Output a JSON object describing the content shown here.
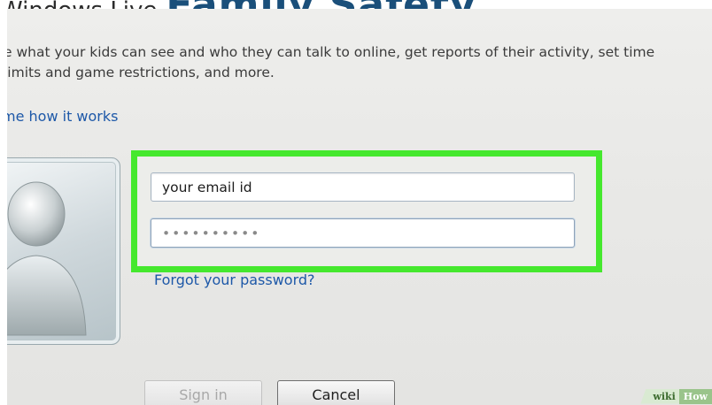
{
  "header": {
    "partial_title": "Windows Live",
    "partial_title_large": "Family Safety"
  },
  "description": "e what your kids can see and who they can talk to online, get reports of their activity, set time limits and game restrictions, and more.",
  "how_it_works_link": "me how it works",
  "signin_form": {
    "email_value": "your email id",
    "password_mask": "••••••••••",
    "forgot_password_link": "Forgot your password?",
    "highlight_color": "#45e82e"
  },
  "buttons": {
    "signin_label": "Sign in",
    "cancel_label": "Cancel"
  },
  "watermark": {
    "part1": "wiki",
    "part2": "How"
  },
  "icons": {
    "avatar": "user-silhouette-icon"
  }
}
